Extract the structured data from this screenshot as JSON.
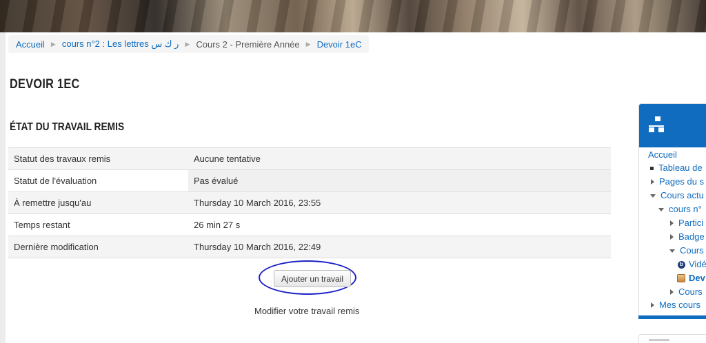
{
  "breadcrumb": {
    "home": "Accueil",
    "course": "cours n°2 : Les lettres ر ك س",
    "section": "Cours 2 - Première Année",
    "current": "Devoir 1eC"
  },
  "page": {
    "title": "Devoir 1eC",
    "section_title": "État du travail remis"
  },
  "status_table": [
    {
      "label": "Statut des travaux remis",
      "value": "Aucune tentative"
    },
    {
      "label": "Statut de l'évaluation",
      "value": "Pas évalué"
    },
    {
      "label": "À remettre jusqu'au",
      "value": "Thursday 10 March 2016, 23:55"
    },
    {
      "label": "Temps restant",
      "value": "26 min 27 s"
    },
    {
      "label": "Dernière modification",
      "value": "Thursday 10 March 2016, 22:49"
    }
  ],
  "actions": {
    "add_submission": "Ajouter un travail",
    "modify_hint": "Modifier votre travail remis"
  },
  "navigation": {
    "icon": "sitemap-icon",
    "items": [
      {
        "label": "Accueil",
        "depth": 0,
        "marker": "none"
      },
      {
        "label": "Tableau de",
        "depth": 1,
        "marker": "bullet"
      },
      {
        "label": "Pages du s",
        "depth": 1,
        "marker": "collapsed"
      },
      {
        "label": "Cours actu",
        "depth": 1,
        "marker": "expanded"
      },
      {
        "label": "cours n°",
        "depth": 2,
        "marker": "expanded"
      },
      {
        "label": "Partici",
        "depth": 3,
        "marker": "collapsed"
      },
      {
        "label": "Badge",
        "depth": 3,
        "marker": "collapsed"
      },
      {
        "label": "Cours",
        "depth": 3,
        "marker": "expanded"
      },
      {
        "label": "Vidé",
        "depth": 4,
        "marker": "video-icon"
      },
      {
        "label": "Dev",
        "depth": 4,
        "marker": "assignment-icon"
      },
      {
        "label": "Cours",
        "depth": 3,
        "marker": "collapsed"
      },
      {
        "label": "Mes cours",
        "depth": 1,
        "marker": "collapsed"
      }
    ]
  },
  "colors": {
    "link": "#0f6cbf",
    "block_header": "#0f6cbf",
    "annotation_circle": "#1a1fc4"
  }
}
